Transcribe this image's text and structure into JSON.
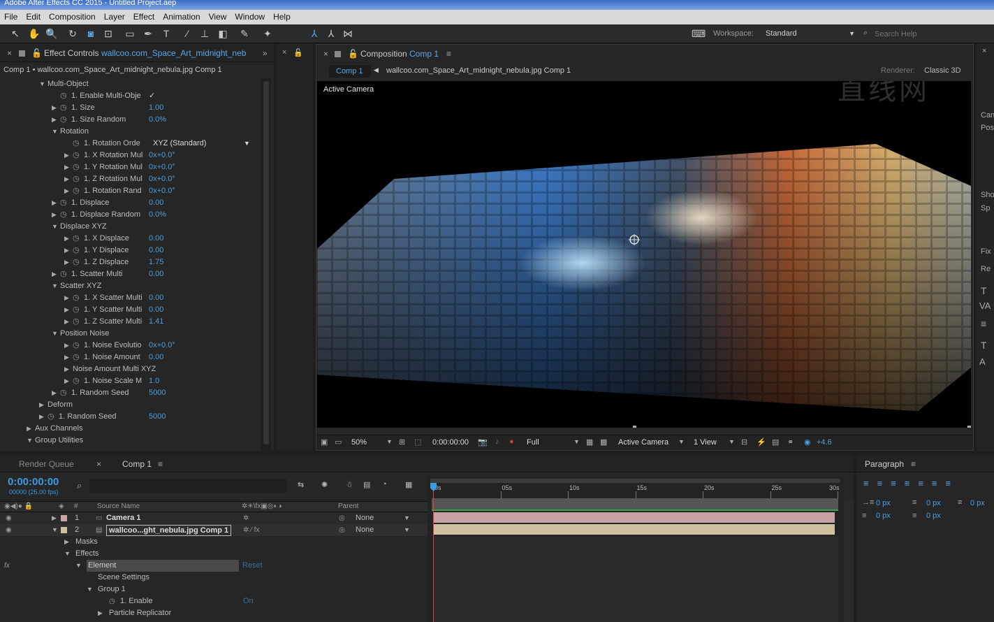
{
  "app": {
    "title": "Adobe After Effects CC 2015 - Untitled Project.aep"
  },
  "menu": [
    "File",
    "Edit",
    "Composition",
    "Layer",
    "Effect",
    "Animation",
    "View",
    "Window",
    "Help"
  ],
  "toolbar": {
    "workspace_label": "Workspace:",
    "workspace_value": "Standard",
    "search_placeholder": "Search Help"
  },
  "effect_controls": {
    "tab_title": "Effect Controls",
    "tab_file": "wallcoo.com_Space_Art_midnight_nebul",
    "breadcrumb": "Comp 1 • wallcoo.com_Space_Art_midnight_nebula.jpg Comp 1",
    "rows": [
      {
        "indent": 56,
        "tri": "▼",
        "stop": false,
        "label": "Multi-Object",
        "value": ""
      },
      {
        "indent": 74,
        "tri": "",
        "stop": true,
        "label": "1. Enable Multi-Obje",
        "value": "✓"
      },
      {
        "indent": 74,
        "tri": "▶",
        "stop": true,
        "label": "1. Size",
        "value": "1.00"
      },
      {
        "indent": 74,
        "tri": "▶",
        "stop": true,
        "label": "1. Size Random",
        "value": "0.0%"
      },
      {
        "indent": 74,
        "tri": "▼",
        "stop": false,
        "label": "Rotation",
        "value": ""
      },
      {
        "indent": 92,
        "tri": "",
        "stop": true,
        "label": "1. Rotation Orde",
        "value": "",
        "dropdown": "XYZ (Standard)"
      },
      {
        "indent": 92,
        "tri": "▶",
        "stop": true,
        "label": "1. X Rotation Mul",
        "value": "0x+0.0°"
      },
      {
        "indent": 92,
        "tri": "▶",
        "stop": true,
        "label": "1. Y Rotation Mul",
        "value": "0x+0.0°"
      },
      {
        "indent": 92,
        "tri": "▶",
        "stop": true,
        "label": "1. Z Rotation Mul",
        "value": "0x+0.0°"
      },
      {
        "indent": 92,
        "tri": "▶",
        "stop": true,
        "label": "1. Rotation Rand",
        "value": "0x+0.0°"
      },
      {
        "indent": 74,
        "tri": "▶",
        "stop": true,
        "label": "1. Displace",
        "value": "0.00"
      },
      {
        "indent": 74,
        "tri": "▶",
        "stop": true,
        "label": "1. Displace Random",
        "value": "0.0%"
      },
      {
        "indent": 74,
        "tri": "▼",
        "stop": false,
        "label": "Displace XYZ",
        "value": ""
      },
      {
        "indent": 92,
        "tri": "▶",
        "stop": true,
        "label": "1. X Displace",
        "value": "0.00"
      },
      {
        "indent": 92,
        "tri": "▶",
        "stop": true,
        "label": "1. Y Displace",
        "value": "0.00"
      },
      {
        "indent": 92,
        "tri": "▶",
        "stop": true,
        "label": "1. Z Displace",
        "value": "1.75"
      },
      {
        "indent": 74,
        "tri": "▶",
        "stop": true,
        "label": "1. Scatter Multi",
        "value": "0.00"
      },
      {
        "indent": 74,
        "tri": "▼",
        "stop": false,
        "label": "Scatter XYZ",
        "value": ""
      },
      {
        "indent": 92,
        "tri": "▶",
        "stop": true,
        "label": "1. X Scatter Multi",
        "value": "0.00"
      },
      {
        "indent": 92,
        "tri": "▶",
        "stop": true,
        "label": "1. Y Scatter Multi",
        "value": "0.00"
      },
      {
        "indent": 92,
        "tri": "▶",
        "stop": true,
        "label": "1. Z Scatter Multi",
        "value": "1.41"
      },
      {
        "indent": 74,
        "tri": "▼",
        "stop": false,
        "label": "Position Noise",
        "value": ""
      },
      {
        "indent": 92,
        "tri": "▶",
        "stop": true,
        "label": "1. Noise Evolutio",
        "value": "0x+0.0°"
      },
      {
        "indent": 92,
        "tri": "▶",
        "stop": true,
        "label": "1. Noise Amount",
        "value": "0.00"
      },
      {
        "indent": 92,
        "tri": "▶",
        "stop": false,
        "label": "Noise Amount Multi XYZ",
        "value": ""
      },
      {
        "indent": 92,
        "tri": "▶",
        "stop": true,
        "label": "1. Noise Scale M",
        "value": "1.0"
      },
      {
        "indent": 74,
        "tri": "▶",
        "stop": true,
        "label": "1. Random Seed",
        "value": "5000"
      },
      {
        "indent": 56,
        "tri": "▶",
        "stop": false,
        "label": "Deform",
        "value": ""
      },
      {
        "indent": 56,
        "tri": "▶",
        "stop": true,
        "label": "1. Random Seed",
        "value": "5000"
      },
      {
        "indent": 38,
        "tri": "▶",
        "stop": false,
        "label": "Aux Channels",
        "value": ""
      },
      {
        "indent": 38,
        "tri": "▼",
        "stop": false,
        "label": "Group Utilities",
        "value": ""
      }
    ]
  },
  "composition": {
    "tab_title": "Composition",
    "tab_comp": "Comp 1",
    "crumb_active": "Comp 1",
    "crumb_next": "wallcoo.com_Space_Art_midnight_nebula.jpg Comp 1",
    "renderer_label": "Renderer:",
    "renderer_value": "Classic 3D",
    "viewer_label": "Active Camera",
    "footer": {
      "zoom": "50%",
      "timecode": "0:00:00:00",
      "resolution": "Full",
      "view": "Active Camera",
      "views": "1 View",
      "exposure": "+4.6"
    }
  },
  "right_panel": {
    "labels": [
      "Can",
      "Pos",
      "Sho",
      "Sp",
      "Fix",
      "Re"
    ]
  },
  "timeline": {
    "tabs": [
      "Render Queue",
      "Comp 1"
    ],
    "timecode": "0:00:00:00",
    "fps": "00000 (25.00 fps)",
    "col_num": "#",
    "col_source": "Source Name",
    "col_parent": "Parent",
    "ruler": [
      "0s",
      "05s",
      "10s",
      "15s",
      "20s",
      "25s",
      "30s"
    ],
    "layers": [
      {
        "num": "1",
        "name": "Camera 1",
        "parent": "None"
      },
      {
        "num": "2",
        "name": "wallcoo...ght_nebula.jpg Comp 1",
        "parent": "None"
      }
    ],
    "subrows": [
      {
        "indent": 92,
        "tri": "▶",
        "label": "Masks",
        "value": ""
      },
      {
        "indent": 92,
        "tri": "▼",
        "label": "Effects",
        "value": ""
      },
      {
        "indent": 108,
        "tri": "▼",
        "label": "Element",
        "value": "Reset"
      },
      {
        "indent": 124,
        "tri": "",
        "label": "Scene Settings",
        "value": ""
      },
      {
        "indent": 124,
        "tri": "▼",
        "label": "Group 1",
        "value": ""
      },
      {
        "indent": 140,
        "tri": "",
        "label": "1. Enable",
        "value": "On",
        "stop": true
      },
      {
        "indent": 140,
        "tri": "▶",
        "label": "Particle Replicator",
        "value": ""
      }
    ]
  },
  "paragraph": {
    "title": "Paragraph",
    "fields": [
      "0 px",
      "0 px",
      "0 px",
      "0 px",
      "0 px"
    ]
  },
  "colors": {
    "accent": "#4a9fe0",
    "bg": "#262626",
    "timecode": "#3a9be0"
  }
}
